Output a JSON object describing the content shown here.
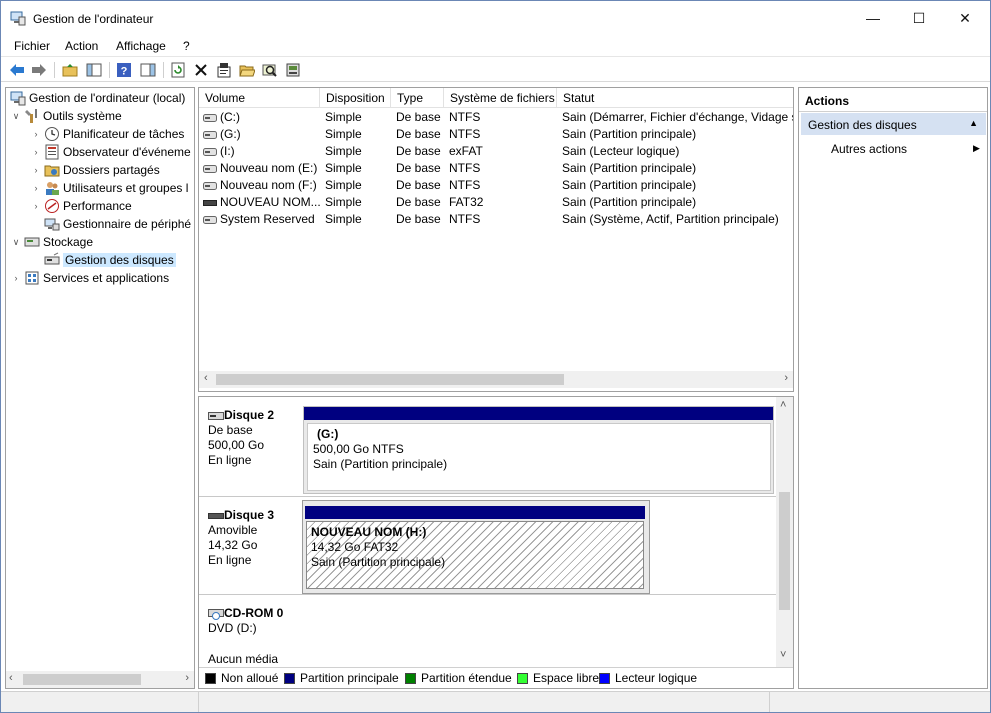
{
  "window": {
    "title": "Gestion de l'ordinateur"
  },
  "menu": [
    "Fichier",
    "Action",
    "Affichage",
    "?"
  ],
  "tree": {
    "root": "Gestion de l'ordinateur (local)",
    "items": [
      {
        "label": "Outils système"
      },
      {
        "label": "Planificateur de tâches"
      },
      {
        "label": "Observateur d'événeme"
      },
      {
        "label": "Dossiers partagés"
      },
      {
        "label": "Utilisateurs et groupes l"
      },
      {
        "label": "Performance"
      },
      {
        "label": "Gestionnaire de périphé"
      },
      {
        "label": "Stockage"
      },
      {
        "label": "Gestion des disques"
      },
      {
        "label": "Services et applications"
      }
    ]
  },
  "volumes": {
    "columns": [
      "Volume",
      "Disposition",
      "Type",
      "Système de fichiers",
      "Statut"
    ],
    "rows": [
      [
        "(C:)",
        "Simple",
        "De base",
        "NTFS",
        "Sain (Démarrer, Fichier d'échange, Vidage su"
      ],
      [
        "(G:)",
        "Simple",
        "De base",
        "NTFS",
        "Sain (Partition principale)"
      ],
      [
        "(I:)",
        "Simple",
        "De base",
        "exFAT",
        "Sain (Lecteur logique)"
      ],
      [
        "Nouveau nom (E:)",
        "Simple",
        "De base",
        "NTFS",
        "Sain (Partition principale)"
      ],
      [
        "Nouveau nom (F:)",
        "Simple",
        "De base",
        "NTFS",
        "Sain (Partition principale)"
      ],
      [
        "NOUVEAU NOM...",
        "Simple",
        "De base",
        "FAT32",
        "Sain (Partition principale)"
      ],
      [
        "System Reserved",
        "Simple",
        "De base",
        "NTFS",
        "Sain (Système, Actif, Partition principale)"
      ]
    ]
  },
  "disks": [
    {
      "name": "Disque 2",
      "type": "De base",
      "size": "500,00 Go",
      "status": "En ligne",
      "partition": {
        "name": "(G:)",
        "detail": "500,00 Go NTFS",
        "state": "Sain (Partition principale)"
      }
    },
    {
      "name": "Disque 3",
      "type": "Amovible",
      "size": "14,32 Go",
      "status": "En ligne",
      "partition": {
        "name": "NOUVEAU NOM  (H:)",
        "detail": "14,32 Go FAT32",
        "state": "Sain (Partition principale)"
      }
    },
    {
      "name": "CD-ROM 0",
      "type": "DVD (D:)",
      "status": "Aucun média"
    }
  ],
  "legend": [
    {
      "label": "Non alloué",
      "color": "#000000"
    },
    {
      "label": "Partition principale",
      "color": "#000080"
    },
    {
      "label": "Partition étendue",
      "color": "#008000"
    },
    {
      "label": "Espace libre",
      "color": "#33ff33"
    },
    {
      "label": "Lecteur logique",
      "color": "#0000ff"
    }
  ],
  "actions": {
    "header": "Actions",
    "section": "Gestion des disques",
    "item": "Autres actions"
  }
}
